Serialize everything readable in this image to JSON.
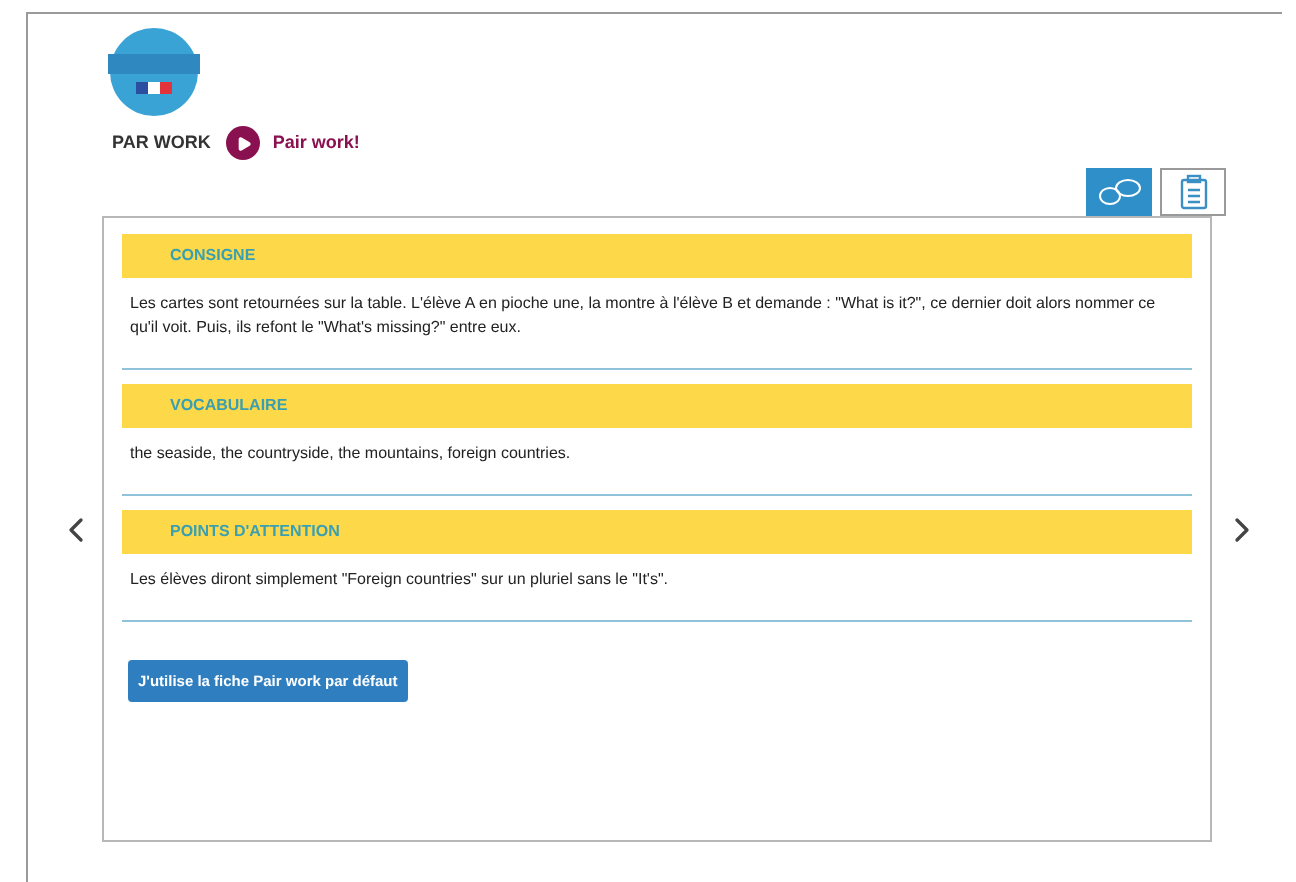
{
  "header": {
    "label": "PAR WORK",
    "link": "Pair work!"
  },
  "tabs": [
    {
      "kind": "chat",
      "selected": true
    },
    {
      "kind": "clipboard",
      "selected": false
    }
  ],
  "sections": [
    {
      "title": "CONSIGNE",
      "text": "Les cartes sont retournées sur la table. L'élève A en pioche une, la montre à l'élève B et demande : \"What is it?\", ce dernier doit alors nommer ce qu'il voit. Puis, ils refont le \"What's missing?\" entre eux."
    },
    {
      "title": "VOCABULAIRE",
      "text": "the seaside, the countryside, the mountains, foreign countries."
    },
    {
      "title": "POINTS D'ATTENTION",
      "text": "Les élèves diront simplement \"Foreign countries\" sur un pluriel sans le \"It's\"."
    }
  ],
  "button": "J'utilise la fiche Pair work par défaut"
}
